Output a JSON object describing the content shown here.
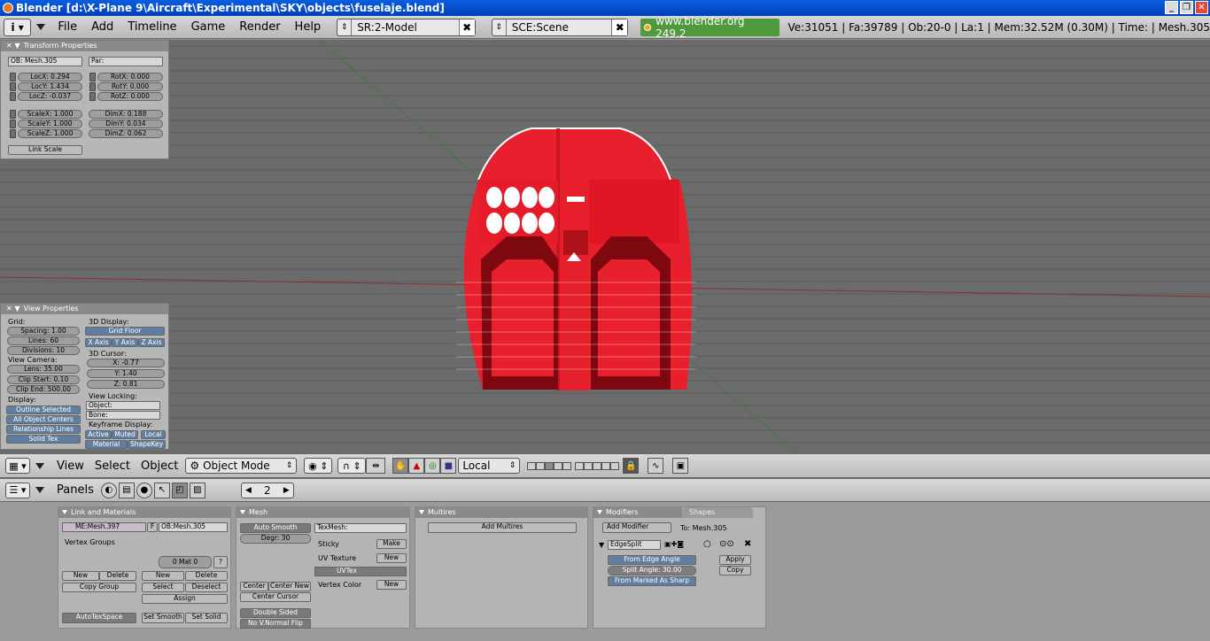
{
  "titlebar": {
    "title": "Blender [d:\\X-Plane 9\\Aircraft\\Experimental\\SKY\\objects\\fuselaje.blend]",
    "min": "_",
    "max": "❐",
    "close": "✕"
  },
  "topmenu": {
    "items": [
      "File",
      "Add",
      "Timeline",
      "Game",
      "Render",
      "Help"
    ]
  },
  "screen": {
    "value": "SR:2-Model"
  },
  "scene": {
    "value": "SCE:Scene"
  },
  "blender_org": "www.blender.org 249.2",
  "stats": "Ve:31051 | Fa:39789 | Ob:20-0 | La:1  | Mem:32.52M (0.30M) | Time: | Mesh.305",
  "transform": {
    "title": "Transform Properties",
    "ob": "OB: Mesh.305",
    "par": "Par:",
    "locx": "LocX: 0.294",
    "locy": "LocY: 1.434",
    "locz": "LocZ: -0.037",
    "rotx": "RotX: 0.000",
    "roty": "RotY: 0.000",
    "rotz": "RotZ: 0.000",
    "scalex": "ScaleX: 1.000",
    "scaley": "ScaleY: 1.000",
    "scalez": "ScaleZ: 1.000",
    "dimx": "DimX: 0.188",
    "dimy": "DimY: 0.034",
    "dimz": "DimZ: 0.062",
    "link_scale": "Link Scale"
  },
  "viewprops": {
    "title": "View Properties",
    "grid": "Grid:",
    "spacing": "Spacing: 1.00",
    "lines": "Lines: 60",
    "divisions": "Divisions: 10",
    "view_camera": "View Camera:",
    "lens": "Lens: 35.00",
    "clip_start": "Clip Start: 0.10",
    "clip_end": "Clip End: 500.00",
    "display": "Display:",
    "outline": "Outline Selected",
    "centers": "All Object Centers",
    "rel": "Relationship Lines",
    "solid": "Solid Tex",
    "disp3d": "3D Display:",
    "gridfloor": "Grid Floor",
    "xaxis": "X Axis",
    "yaxis": "Y Axis",
    "zaxis": "Z Axis",
    "cursor": "3D Cursor:",
    "cx": "X: -0.77",
    "cy": "Y: 1.40",
    "cz": "Z: 0.81",
    "locking": "View Locking:",
    "object": "Object:",
    "bone": "Bone:",
    "keyframe": "Keyframe Display:",
    "active": "Active",
    "muted": "Muted",
    "local": "Local",
    "material": "Material",
    "shapekey": "ShapeKey"
  },
  "header3d": {
    "view": "View",
    "select": "Select",
    "object": "Object",
    "mode": "Object Mode",
    "orient": "Local"
  },
  "buttons_header": {
    "panels": "Panels",
    "frame": "2"
  },
  "link_materials": {
    "title": "Link and Materials",
    "me": "ME:Mesh.397",
    "f": "F",
    "ob": "OB:Mesh.305",
    "vgroups": "Vertex Groups",
    "mat": "0 Mat 0",
    "q": "?",
    "new1": "New",
    "delete1": "Delete",
    "copygroup": "Copy Group",
    "new2": "New",
    "delete2": "Delete",
    "select": "Select",
    "deselect": "Deselect",
    "assign": "Assign",
    "autotex": "AutoTexSpace",
    "setsmooth": "Set Smooth",
    "setsolid": "Set Solid"
  },
  "mesh": {
    "title": "Mesh",
    "autosmooth": "Auto Smooth",
    "degr": "Degr: 30",
    "texmesh": "TexMesh:",
    "sticky": "Sticky",
    "make": "Make",
    "uvtex": "UV Texture",
    "new": "New",
    "uvtexname": "UVTex",
    "vcol": "Vertex Color",
    "new2": "New",
    "center": "Center",
    "centernew": "Center New",
    "centercursor": "Center Cursor",
    "doublesided": "Double Sided",
    "nonormal": "No V.Normal Flip"
  },
  "multires": {
    "title": "Multires",
    "add": "Add Multires"
  },
  "modifiers": {
    "tab1": "Modifiers",
    "tab2": "Shapes",
    "add": "Add Modifier",
    "to": "To: Mesh.305",
    "name": "EdgeSplit",
    "fromangle": "From Edge Angle",
    "splitangle": "Split Angle: 30.00",
    "fromsharp": "From Marked As Sharp",
    "apply": "Apply",
    "copy": "Copy"
  },
  "colors": {
    "fuselage": "#e8202e",
    "fuselage_dark": "#7d0810",
    "grid_bg": "#6a6a6a"
  }
}
